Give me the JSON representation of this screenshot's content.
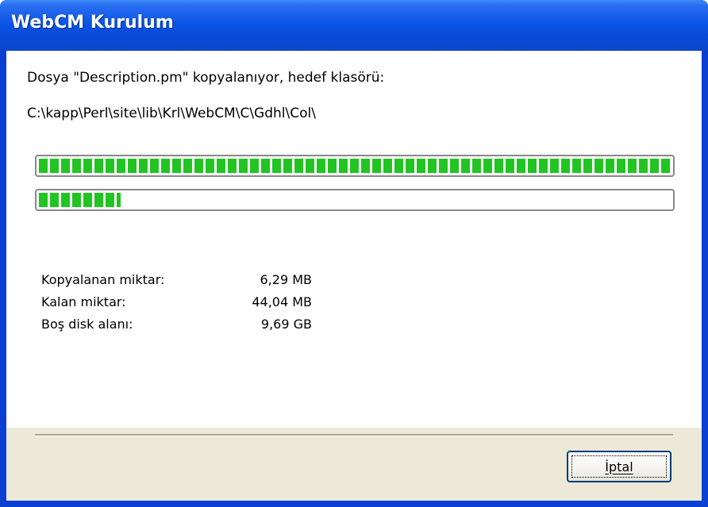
{
  "window": {
    "title": "WebCM Kurulum"
  },
  "status": {
    "copying_line": "Dosya \"Description.pm\" kopyalanıyor, hedef klasörü:",
    "target_path": "C:\\kapp\\Perl\\site\\lib\\Krl\\WebCM\\C\\Gdhl\\Col\\"
  },
  "progress": {
    "overall_fraction": 1.0,
    "file_fraction": 0.13
  },
  "stats": [
    {
      "label": "Kopyalanan miktar:",
      "value": "6,29 MB"
    },
    {
      "label": "Kalan miktar:",
      "value": "44,04 MB"
    },
    {
      "label": "Boş disk alanı:",
      "value": "9,69 GB"
    }
  ],
  "buttons": {
    "cancel_label": "İptal"
  },
  "colors": {
    "titlebar": "#0a4ad8",
    "progress_fill": "#22c422",
    "dialog_bg": "#ece9d8"
  }
}
